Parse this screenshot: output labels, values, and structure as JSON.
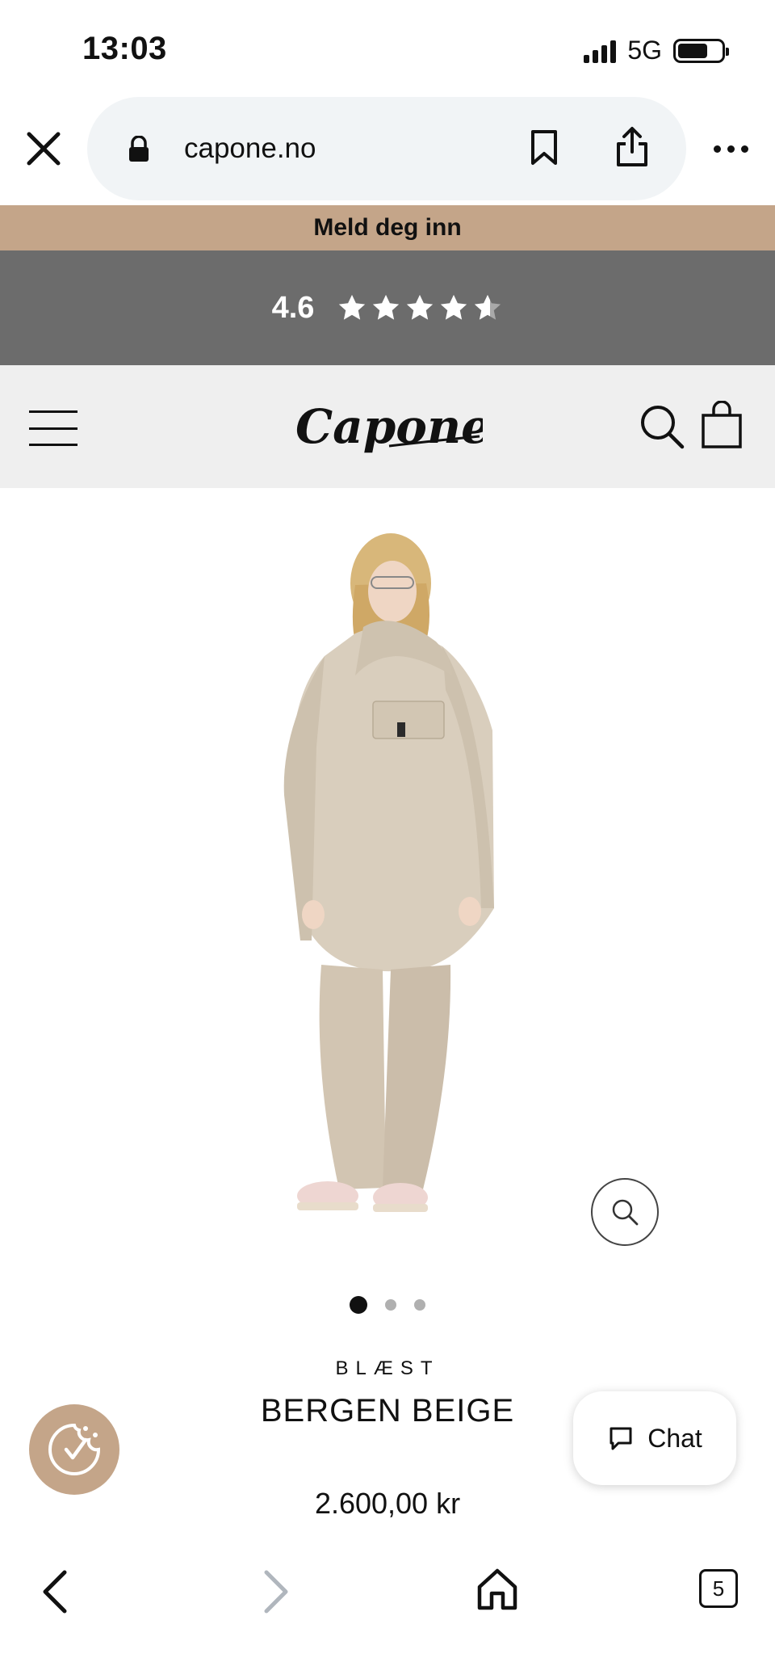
{
  "status_bar": {
    "time": "13:03",
    "network": "5G"
  },
  "browser": {
    "url": "capone.no"
  },
  "promo_banner": {
    "text": "Meld deg inn"
  },
  "rating": {
    "value_text": "4.6",
    "value": 4.6,
    "max": 5
  },
  "header": {
    "logo_text": "Capone"
  },
  "carousel": {
    "slide_count": 3,
    "active_index": 0
  },
  "product": {
    "brand": "BLÆST",
    "name": "BERGEN BEIGE",
    "price": "2.600,00 kr"
  },
  "chat": {
    "label": "Chat"
  },
  "tabs": {
    "count": "5"
  },
  "colors": {
    "promo_bg": "#c4a589",
    "rating_bg": "#6c6c6c",
    "header_bg": "#efefef",
    "product_fabric": "#d9cebd"
  },
  "icons": [
    "close-icon",
    "lock-icon",
    "bookmark-icon",
    "share-icon",
    "more-icon",
    "star-icon",
    "menu-icon",
    "search-icon",
    "shopping-bag-icon",
    "zoom-icon",
    "cookie-icon",
    "chat-icon",
    "back-icon",
    "forward-icon",
    "home-icon",
    "tabs-icon"
  ]
}
